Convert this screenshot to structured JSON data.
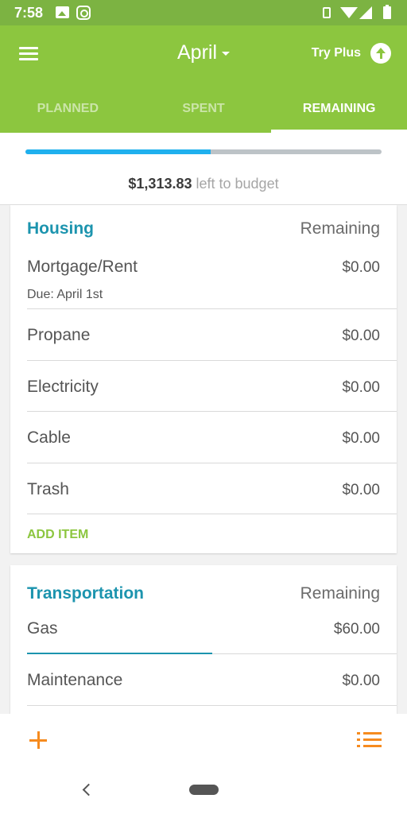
{
  "status_bar": {
    "time": "7:58"
  },
  "header": {
    "month": "April",
    "try_plus": "Try Plus",
    "tabs": [
      {
        "label": "PLANNED",
        "active": false
      },
      {
        "label": "SPENT",
        "active": false
      },
      {
        "label": "REMAINING",
        "active": true
      }
    ]
  },
  "summary": {
    "amount": "$1,313.83",
    "suffix": "left to budget",
    "progress_fraction": 0.52
  },
  "groups": [
    {
      "title": "Housing",
      "column_label": "Remaining",
      "items": [
        {
          "name": "Mortgage/Rent",
          "amount": "$0.00",
          "due": "Due: April 1st"
        },
        {
          "name": "Propane",
          "amount": "$0.00"
        },
        {
          "name": "Electricity",
          "amount": "$0.00"
        },
        {
          "name": "Cable",
          "amount": "$0.00"
        },
        {
          "name": "Trash",
          "amount": "$0.00"
        }
      ],
      "add_item_label": "ADD ITEM"
    },
    {
      "title": "Transportation",
      "column_label": "Remaining",
      "items": [
        {
          "name": "Gas",
          "amount": "$60.00",
          "progress_fraction": 0.5
        },
        {
          "name": "Maintenance",
          "amount": "$0.00"
        }
      ]
    }
  ],
  "colors": {
    "primary_green": "#8cc63f",
    "status_bar_green": "#7cb342",
    "category_title": "#1c94ae",
    "progress_blue": "#1fb0ee",
    "accent_orange": "#f68b1f"
  },
  "icons": {
    "menu": "hamburger-menu-icon",
    "try_plus": "arrow-up-circle-icon",
    "add": "plus-icon",
    "list": "list-icon",
    "back": "back-chevron-icon",
    "home": "home-pill-icon"
  }
}
